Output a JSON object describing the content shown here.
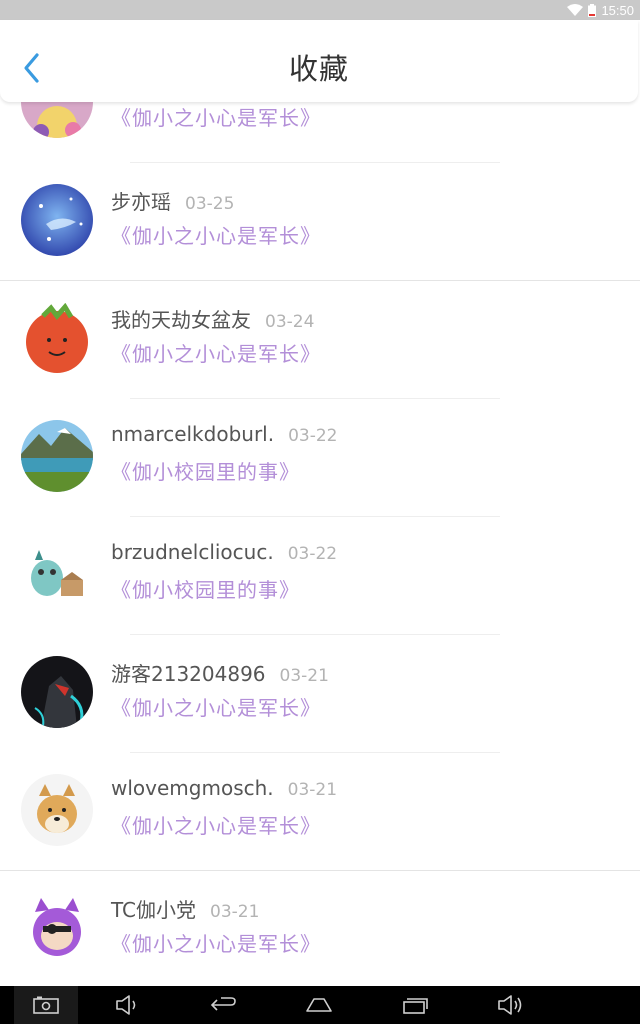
{
  "status_bar": {
    "time": "15:50"
  },
  "header": {
    "title": "收藏"
  },
  "items": [
    {
      "name": "",
      "date": "",
      "comic": "《伽小之小心是军长》"
    },
    {
      "name": "步亦瑶",
      "date": "03-25",
      "comic": "《伽小之小心是军长》"
    },
    {
      "name": "我的天劫女盆友",
      "date": "03-24",
      "comic": "《伽小之小心是军长》"
    },
    {
      "name": "nmarcelkdoburl.",
      "date": "03-22",
      "comic": "《伽小校园里的事》"
    },
    {
      "name": "brzudnelcliocuc.",
      "date": "03-22",
      "comic": "《伽小校园里的事》"
    },
    {
      "name": "游客213204896",
      "date": "03-21",
      "comic": "《伽小之小心是军长》"
    },
    {
      "name": "wlovemgmosch.",
      "date": "03-21",
      "comic": "《伽小之小心是军长》"
    },
    {
      "name": "TC伽小党",
      "date": "03-21",
      "comic": "《伽小之小心是军长》"
    }
  ],
  "colors": {
    "accent": "#3a9be0",
    "comic_title": "#b38fd8",
    "status_bar": "#c9c9c9"
  },
  "nav_icons": [
    "screenshot-icon",
    "volume-down-icon",
    "back-icon",
    "home-icon",
    "recents-icon",
    "volume-up-icon"
  ]
}
